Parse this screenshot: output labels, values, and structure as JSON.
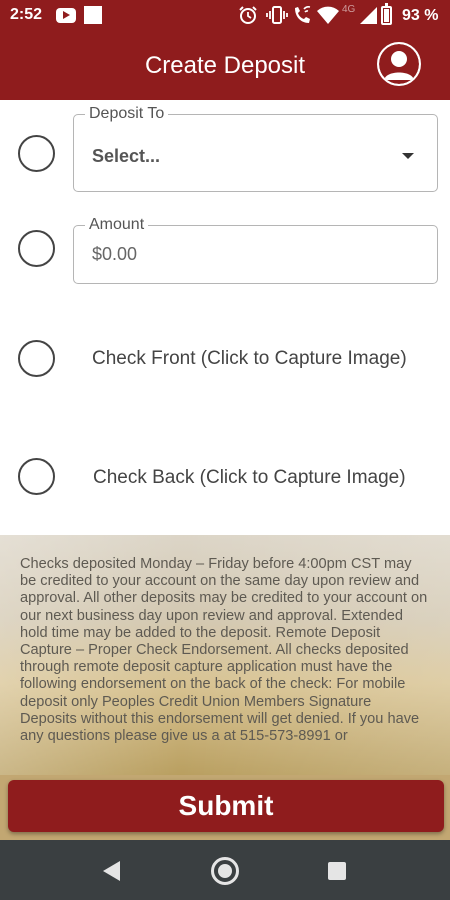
{
  "status_bar": {
    "time": "2:52",
    "network": "4G",
    "battery": "93 %",
    "icons": [
      "youtube-icon",
      "notification-square-icon",
      "alarm-icon",
      "vibrate-icon",
      "wifi-calling-icon",
      "wifi-icon",
      "signal-icon",
      "battery-icon"
    ]
  },
  "header": {
    "title": "Create Deposit",
    "profile_icon": "user-profile-icon"
  },
  "form": {
    "deposit_to": {
      "label": "Deposit To",
      "value": "Select..."
    },
    "amount": {
      "label": "Amount",
      "placeholder": "$0.00"
    },
    "check_front": {
      "label": "Check Front (Click to Capture Image)"
    },
    "check_back": {
      "label": "Check Back (Click to Capture Image)"
    }
  },
  "disclaimer": {
    "text": "Checks deposited Monday – Friday before 4:00pm CST may be credited to your account on the same day upon review and approval. All other deposits may be credited to your account on our next business day upon review and approval. Extended hold time may be added to the deposit.  Remote Deposit Capture – Proper Check Endorsement.  All checks deposited through remote deposit capture application must have the following endorsement on the back of the check:  For mobile deposit only Peoples Credit Union Members Signature Deposits without this endorsement will get denied. If you have any questions please give us a at 515-573-8991 or"
  },
  "submit": {
    "label": "Submit"
  },
  "nav_bar": {
    "icons": [
      "back-icon",
      "home-icon",
      "recents-icon"
    ]
  },
  "colors": {
    "brand": "#8f1c1d",
    "nav": "#3a3f41"
  }
}
